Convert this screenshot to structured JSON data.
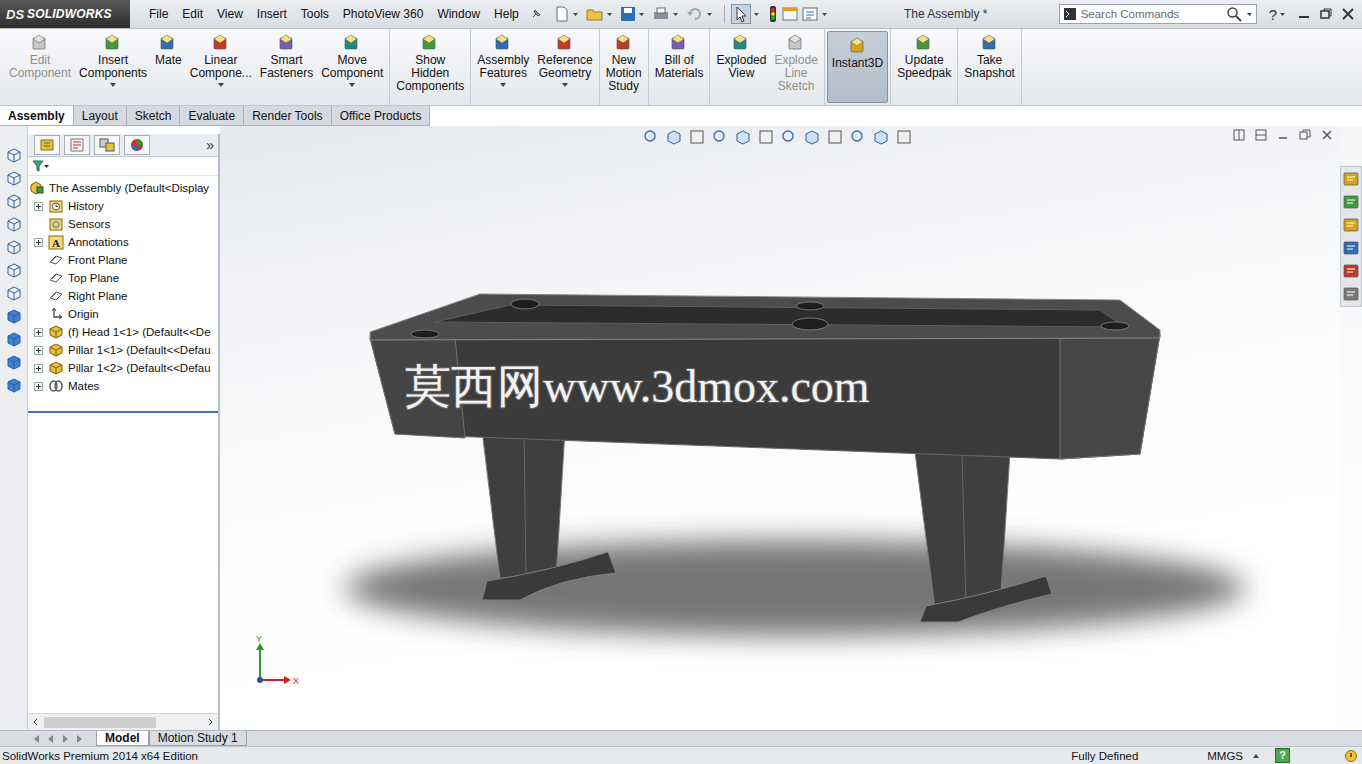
{
  "app": {
    "logo_mark": "DS",
    "logo_text": "SOLIDWORKS"
  },
  "menus": [
    "File",
    "Edit",
    "View",
    "Insert",
    "Tools",
    "PhotoView 360",
    "Window",
    "Help"
  ],
  "window": {
    "title": "The Assembly *"
  },
  "search": {
    "placeholder": "Search Commands"
  },
  "help_button": "?",
  "ribbon_groups": [
    [
      {
        "lines": [
          "Edit",
          "Component"
        ],
        "disabled": true,
        "selected": false,
        "has_menu": false
      },
      {
        "lines": [
          "Insert",
          "Components"
        ],
        "disabled": false,
        "selected": false,
        "has_menu": true
      },
      {
        "lines": [
          "Mate"
        ],
        "disabled": false,
        "selected": false,
        "has_menu": false
      },
      {
        "lines": [
          "Linear",
          "Compone..."
        ],
        "disabled": false,
        "selected": false,
        "has_menu": true
      },
      {
        "lines": [
          "Smart",
          "Fasteners"
        ],
        "disabled": false,
        "selected": false,
        "has_menu": false
      },
      {
        "lines": [
          "Move",
          "Component"
        ],
        "disabled": false,
        "selected": false,
        "has_menu": true
      }
    ],
    [
      {
        "lines": [
          "Show",
          "Hidden",
          "Components"
        ],
        "disabled": false,
        "selected": false,
        "has_menu": false
      }
    ],
    [
      {
        "lines": [
          "Assembly",
          "Features"
        ],
        "disabled": false,
        "selected": false,
        "has_menu": true
      },
      {
        "lines": [
          "Reference",
          "Geometry"
        ],
        "disabled": false,
        "selected": false,
        "has_menu": true
      }
    ],
    [
      {
        "lines": [
          "New",
          "Motion",
          "Study"
        ],
        "disabled": false,
        "selected": false,
        "has_menu": false
      }
    ],
    [
      {
        "lines": [
          "Bill of",
          "Materials"
        ],
        "disabled": false,
        "selected": false,
        "has_menu": false
      }
    ],
    [
      {
        "lines": [
          "Exploded",
          "View"
        ],
        "disabled": false,
        "selected": false,
        "has_menu": false
      },
      {
        "lines": [
          "Explode",
          "Line",
          "Sketch"
        ],
        "disabled": true,
        "selected": false,
        "has_menu": false
      }
    ],
    [
      {
        "lines": [
          "Instant3D"
        ],
        "disabled": false,
        "selected": true,
        "has_menu": false
      }
    ],
    [
      {
        "lines": [
          "Update",
          "Speedpak"
        ],
        "disabled": false,
        "selected": false,
        "has_menu": false
      }
    ],
    [
      {
        "lines": [
          "Take",
          "Snapshot"
        ],
        "disabled": false,
        "selected": false,
        "has_menu": false
      }
    ]
  ],
  "command_tabs": [
    {
      "label": "Assembly",
      "selected": true
    },
    {
      "label": "Layout",
      "selected": false
    },
    {
      "label": "Sketch",
      "selected": false
    },
    {
      "label": "Evaluate",
      "selected": false
    },
    {
      "label": "Render Tools",
      "selected": false
    },
    {
      "label": "Office Products",
      "selected": false
    }
  ],
  "panel": {
    "collapse": "»"
  },
  "tree": [
    {
      "label": "The Assembly (Default<Display",
      "kind": "assembly",
      "depth": 0,
      "expandable": false
    },
    {
      "label": "History",
      "kind": "history",
      "depth": 1,
      "expandable": true
    },
    {
      "label": "Sensors",
      "kind": "sensor",
      "depth": 1,
      "expandable": false
    },
    {
      "label": "Annotations",
      "kind": "annotation",
      "depth": 1,
      "expandable": true,
      "glyph": "A"
    },
    {
      "label": "Front Plane",
      "kind": "plane",
      "depth": 1,
      "expandable": false
    },
    {
      "label": "Top Plane",
      "kind": "plane",
      "depth": 1,
      "expandable": false
    },
    {
      "label": "Right Plane",
      "kind": "plane",
      "depth": 1,
      "expandable": false
    },
    {
      "label": "Origin",
      "kind": "origin",
      "depth": 1,
      "expandable": false
    },
    {
      "label": "(f) Head 1<1> (Default<<De",
      "kind": "part",
      "depth": 1,
      "expandable": true
    },
    {
      "label": "Pillar 1<1> (Default<<Defau",
      "kind": "part",
      "depth": 1,
      "expandable": true
    },
    {
      "label": "Pillar 1<2> (Default<<Defau",
      "kind": "part",
      "depth": 1,
      "expandable": true
    },
    {
      "label": "Mates",
      "kind": "mates",
      "depth": 1,
      "expandable": true
    }
  ],
  "viewport": {
    "watermark": "莫西网www.3dmox.com",
    "axes": {
      "y": "Y",
      "x": "X"
    }
  },
  "bottom_tabs": [
    {
      "label": "Model",
      "selected": true
    },
    {
      "label": "Motion Study 1",
      "selected": false
    }
  ],
  "status_bar": {
    "edition": "SolidWorks Premium 2014 x64 Edition",
    "state": "Fully Defined",
    "units": "MMGS",
    "help": "?"
  }
}
